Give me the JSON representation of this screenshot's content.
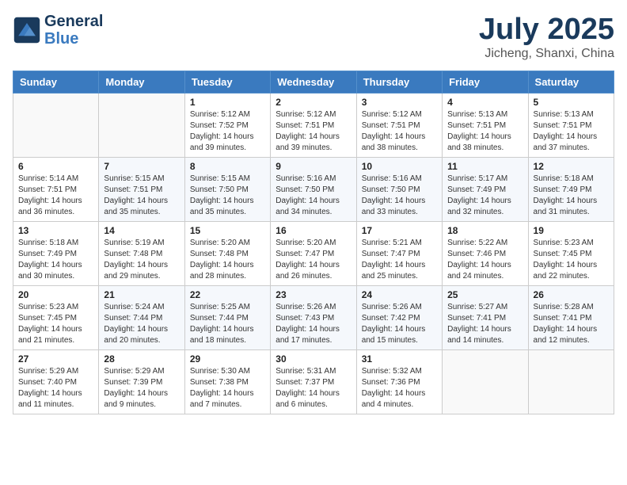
{
  "header": {
    "logo_line1": "General",
    "logo_line2": "Blue",
    "month": "July 2025",
    "location": "Jicheng, Shanxi, China"
  },
  "days_of_week": [
    "Sunday",
    "Monday",
    "Tuesday",
    "Wednesday",
    "Thursday",
    "Friday",
    "Saturday"
  ],
  "weeks": [
    [
      {
        "day": "",
        "sunrise": "",
        "sunset": "",
        "daylight": ""
      },
      {
        "day": "",
        "sunrise": "",
        "sunset": "",
        "daylight": ""
      },
      {
        "day": "1",
        "sunrise": "Sunrise: 5:12 AM",
        "sunset": "Sunset: 7:52 PM",
        "daylight": "Daylight: 14 hours and 39 minutes."
      },
      {
        "day": "2",
        "sunrise": "Sunrise: 5:12 AM",
        "sunset": "Sunset: 7:51 PM",
        "daylight": "Daylight: 14 hours and 39 minutes."
      },
      {
        "day": "3",
        "sunrise": "Sunrise: 5:12 AM",
        "sunset": "Sunset: 7:51 PM",
        "daylight": "Daylight: 14 hours and 38 minutes."
      },
      {
        "day": "4",
        "sunrise": "Sunrise: 5:13 AM",
        "sunset": "Sunset: 7:51 PM",
        "daylight": "Daylight: 14 hours and 38 minutes."
      },
      {
        "day": "5",
        "sunrise": "Sunrise: 5:13 AM",
        "sunset": "Sunset: 7:51 PM",
        "daylight": "Daylight: 14 hours and 37 minutes."
      }
    ],
    [
      {
        "day": "6",
        "sunrise": "Sunrise: 5:14 AM",
        "sunset": "Sunset: 7:51 PM",
        "daylight": "Daylight: 14 hours and 36 minutes."
      },
      {
        "day": "7",
        "sunrise": "Sunrise: 5:15 AM",
        "sunset": "Sunset: 7:51 PM",
        "daylight": "Daylight: 14 hours and 35 minutes."
      },
      {
        "day": "8",
        "sunrise": "Sunrise: 5:15 AM",
        "sunset": "Sunset: 7:50 PM",
        "daylight": "Daylight: 14 hours and 35 minutes."
      },
      {
        "day": "9",
        "sunrise": "Sunrise: 5:16 AM",
        "sunset": "Sunset: 7:50 PM",
        "daylight": "Daylight: 14 hours and 34 minutes."
      },
      {
        "day": "10",
        "sunrise": "Sunrise: 5:16 AM",
        "sunset": "Sunset: 7:50 PM",
        "daylight": "Daylight: 14 hours and 33 minutes."
      },
      {
        "day": "11",
        "sunrise": "Sunrise: 5:17 AM",
        "sunset": "Sunset: 7:49 PM",
        "daylight": "Daylight: 14 hours and 32 minutes."
      },
      {
        "day": "12",
        "sunrise": "Sunrise: 5:18 AM",
        "sunset": "Sunset: 7:49 PM",
        "daylight": "Daylight: 14 hours and 31 minutes."
      }
    ],
    [
      {
        "day": "13",
        "sunrise": "Sunrise: 5:18 AM",
        "sunset": "Sunset: 7:49 PM",
        "daylight": "Daylight: 14 hours and 30 minutes."
      },
      {
        "day": "14",
        "sunrise": "Sunrise: 5:19 AM",
        "sunset": "Sunset: 7:48 PM",
        "daylight": "Daylight: 14 hours and 29 minutes."
      },
      {
        "day": "15",
        "sunrise": "Sunrise: 5:20 AM",
        "sunset": "Sunset: 7:48 PM",
        "daylight": "Daylight: 14 hours and 28 minutes."
      },
      {
        "day": "16",
        "sunrise": "Sunrise: 5:20 AM",
        "sunset": "Sunset: 7:47 PM",
        "daylight": "Daylight: 14 hours and 26 minutes."
      },
      {
        "day": "17",
        "sunrise": "Sunrise: 5:21 AM",
        "sunset": "Sunset: 7:47 PM",
        "daylight": "Daylight: 14 hours and 25 minutes."
      },
      {
        "day": "18",
        "sunrise": "Sunrise: 5:22 AM",
        "sunset": "Sunset: 7:46 PM",
        "daylight": "Daylight: 14 hours and 24 minutes."
      },
      {
        "day": "19",
        "sunrise": "Sunrise: 5:23 AM",
        "sunset": "Sunset: 7:45 PM",
        "daylight": "Daylight: 14 hours and 22 minutes."
      }
    ],
    [
      {
        "day": "20",
        "sunrise": "Sunrise: 5:23 AM",
        "sunset": "Sunset: 7:45 PM",
        "daylight": "Daylight: 14 hours and 21 minutes."
      },
      {
        "day": "21",
        "sunrise": "Sunrise: 5:24 AM",
        "sunset": "Sunset: 7:44 PM",
        "daylight": "Daylight: 14 hours and 20 minutes."
      },
      {
        "day": "22",
        "sunrise": "Sunrise: 5:25 AM",
        "sunset": "Sunset: 7:44 PM",
        "daylight": "Daylight: 14 hours and 18 minutes."
      },
      {
        "day": "23",
        "sunrise": "Sunrise: 5:26 AM",
        "sunset": "Sunset: 7:43 PM",
        "daylight": "Daylight: 14 hours and 17 minutes."
      },
      {
        "day": "24",
        "sunrise": "Sunrise: 5:26 AM",
        "sunset": "Sunset: 7:42 PM",
        "daylight": "Daylight: 14 hours and 15 minutes."
      },
      {
        "day": "25",
        "sunrise": "Sunrise: 5:27 AM",
        "sunset": "Sunset: 7:41 PM",
        "daylight": "Daylight: 14 hours and 14 minutes."
      },
      {
        "day": "26",
        "sunrise": "Sunrise: 5:28 AM",
        "sunset": "Sunset: 7:41 PM",
        "daylight": "Daylight: 14 hours and 12 minutes."
      }
    ],
    [
      {
        "day": "27",
        "sunrise": "Sunrise: 5:29 AM",
        "sunset": "Sunset: 7:40 PM",
        "daylight": "Daylight: 14 hours and 11 minutes."
      },
      {
        "day": "28",
        "sunrise": "Sunrise: 5:29 AM",
        "sunset": "Sunset: 7:39 PM",
        "daylight": "Daylight: 14 hours and 9 minutes."
      },
      {
        "day": "29",
        "sunrise": "Sunrise: 5:30 AM",
        "sunset": "Sunset: 7:38 PM",
        "daylight": "Daylight: 14 hours and 7 minutes."
      },
      {
        "day": "30",
        "sunrise": "Sunrise: 5:31 AM",
        "sunset": "Sunset: 7:37 PM",
        "daylight": "Daylight: 14 hours and 6 minutes."
      },
      {
        "day": "31",
        "sunrise": "Sunrise: 5:32 AM",
        "sunset": "Sunset: 7:36 PM",
        "daylight": "Daylight: 14 hours and 4 minutes."
      },
      {
        "day": "",
        "sunrise": "",
        "sunset": "",
        "daylight": ""
      },
      {
        "day": "",
        "sunrise": "",
        "sunset": "",
        "daylight": ""
      }
    ]
  ]
}
